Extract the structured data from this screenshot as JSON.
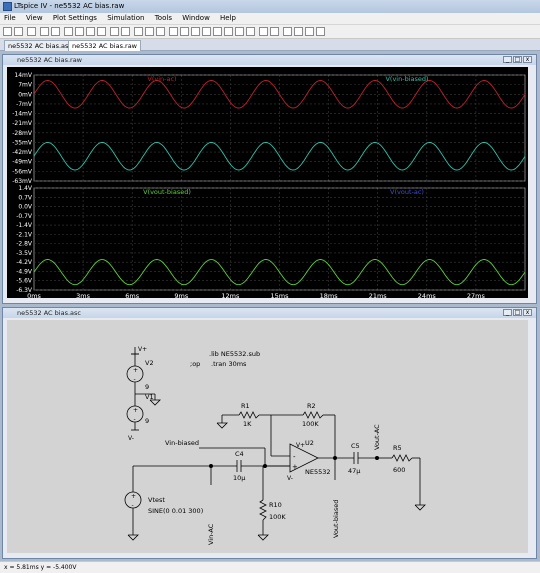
{
  "app": {
    "title": "LTspice IV - ne5532 AC bias.raw"
  },
  "menu": [
    "File",
    "View",
    "Plot Settings",
    "Simulation",
    "Tools",
    "Window",
    "Help"
  ],
  "tabs": [
    {
      "label": "ne5532 AC bias.asc"
    },
    {
      "label": "ne5532 AC bias.raw"
    }
  ],
  "plot_window": {
    "title": "ne5532 AC bias.raw"
  },
  "schematic_window": {
    "title": "ne5532 AC bias.asc"
  },
  "chart_data": [
    {
      "type": "line",
      "title": "",
      "series": [
        {
          "name": "V(vin-ac)",
          "color": "#c0202f",
          "offset_mV": 0,
          "amplitude_mV": 10
        },
        {
          "name": "V(vin-biased)",
          "color": "#2dc1a8",
          "offset_mV": -45,
          "amplitude_mV": 10
        }
      ],
      "y_ticks": [
        "14mV",
        "7mV",
        "0mV",
        "-7mV",
        "-14mV",
        "-21mV",
        "-28mV",
        "-35mV",
        "-42mV",
        "-49mV",
        "-56mV",
        "-63mV"
      ],
      "ylim_mV": [
        -63,
        14
      ],
      "frequency_hz": 300,
      "grid": true
    },
    {
      "type": "line",
      "title": "",
      "series": [
        {
          "name": "V(vout-biased)",
          "color": "#5bd138",
          "offset_V": -4.95,
          "amplitude_V": 0.95
        },
        {
          "name": "V(vout-ac)",
          "color": "#3b4fd6",
          "offset_V": 0,
          "amplitude_V": 0
        }
      ],
      "y_ticks": [
        "1.4V",
        "0.7V",
        "0.0V",
        "-0.7V",
        "-1.4V",
        "-2.1V",
        "-2.8V",
        "-3.5V",
        "-4.2V",
        "-4.9V",
        "-5.6V",
        "-6.3V"
      ],
      "ylim_V": [
        -6.3,
        1.4
      ],
      "frequency_hz": 300,
      "grid": true
    }
  ],
  "x_ticks": [
    "0ms",
    "3ms",
    "6ms",
    "9ms",
    "12ms",
    "15ms",
    "18ms",
    "21ms",
    "24ms",
    "27ms"
  ],
  "xlim_ms": [
    0,
    30
  ],
  "schematic": {
    "directive1": ".lib NE5532.sub",
    "directive2a": ";op",
    "directive2b": ".tran 30ms",
    "V2": "V2",
    "V2_val": "9",
    "V1": "V1",
    "V1_val": "9",
    "R1": "R1",
    "R1_val": "1K",
    "R2": "R2",
    "R2_val": "100K",
    "U2": "U2",
    "U2_part": "NE5532",
    "C4": "C4",
    "C4_val": "10µ",
    "C5": "C5",
    "C5_val": "47µ",
    "R5": "R5",
    "R5_val": "600",
    "R10": "R10",
    "R10_val": "100K",
    "Vtest": "Vtest",
    "Vtest_val": "SINE(0 0.01 300)",
    "net_vin_biased": "Vin-biased",
    "net_vin_ac": "Vin-AC",
    "net_vout_biased": "Vout-biased",
    "net_vout_ac": "Vout-AC",
    "vplus": "V+",
    "vminus": "V-",
    "vplus2": "V+",
    "vminus2": "V-",
    "pin_plus": "+",
    "pin_minus": "-",
    "src_plus": "+",
    "src_minus": "-"
  },
  "status": {
    "text": "x = 5.81ms    y = -5.400V"
  }
}
